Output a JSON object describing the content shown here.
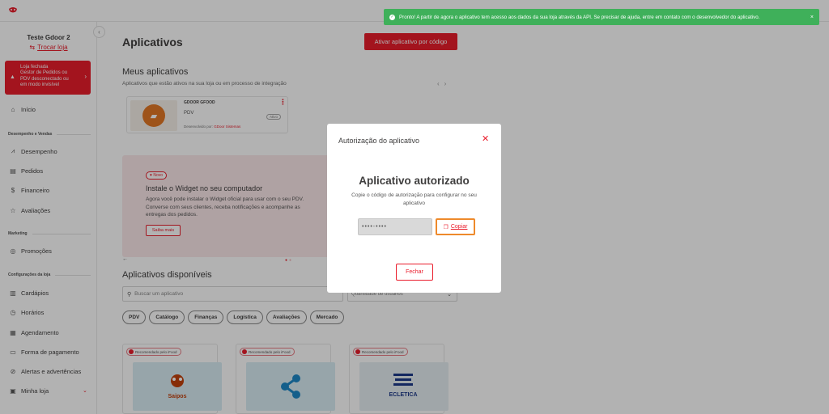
{
  "toast": {
    "message": "Pronto! A partir de agora o aplicativo tem acesso aos dados da sua loja através da API. Se precisar de ajuda, entre em contato com o desenvolvedor do aplicativo.",
    "close": "×"
  },
  "sidebar": {
    "store_name": "Teste Gdoor 2",
    "switch_store": "Trocar loja",
    "alert": {
      "line1": "Loja fechada",
      "line2": "Gestor de Pedidos ou",
      "line3": "PDV desconectado ou",
      "line4": "em modo invisível"
    },
    "home": "Início",
    "section_performance": "Desempenho e Vendas",
    "performance_items": [
      "Desempenho",
      "Pedidos",
      "Financeiro",
      "Avaliações"
    ],
    "section_marketing": "Marketing",
    "marketing_items": [
      "Promoções"
    ],
    "section_config": "Configurações da loja",
    "config_items": [
      "Cardápios",
      "Horários",
      "Agendamento",
      "Forma de pagamento",
      "Alertas e advertências",
      "Minha loja"
    ]
  },
  "main": {
    "title": "Aplicativos",
    "activate_button": "Ativar aplicativo por código",
    "my_apps_title": "Meus aplicativos",
    "my_apps_subtitle": "Aplicativos que estão ativos na sua loja ou em processo de integração",
    "my_app": {
      "name": "GDOOR GFOOD",
      "category": "PDV",
      "developer_prefix": "Desenvolvido por",
      "developer": "GDoor Sistemas",
      "status": "Ativo"
    },
    "banner": {
      "badge": "Novo",
      "title": "Instale o Widget no seu computador",
      "text": "Agora você pode instalar o Widget oficial para usar com o seu PDV. Converse com seus clientes, receba notificações e acompanhe as entregas dos pedidos.",
      "button": "Saiba mais"
    },
    "available_title": "Aplicativos disponíveis",
    "search_placeholder": "Buscar um aplicativo",
    "qty_placeholder": "Quantidade de usuários",
    "chips": [
      "PDV",
      "Catálogo",
      "Finanças",
      "Logística",
      "Avaliações",
      "Mercado"
    ],
    "recommended_label": "Recomendado pelo iFood",
    "available_apps": [
      {
        "logo_text": "Saipos"
      },
      {
        "logo_text": ""
      },
      {
        "logo_text": "ECLETICA"
      }
    ]
  },
  "modal": {
    "title": "Autorização do aplicativo",
    "heading": "Aplicativo autorizado",
    "description": "Copie o código de autorização para configurar no seu aplicativo",
    "code_masked": "••••-••••",
    "copy_label": "Copiar",
    "close_button": "Fechar"
  },
  "colors": {
    "brand": "#ea1d2c",
    "success": "#3fb05a",
    "focus_outline": "#ee8a2b"
  }
}
